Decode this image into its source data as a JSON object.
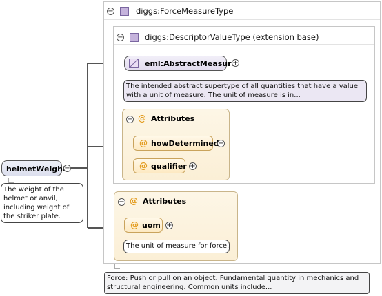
{
  "root_element": {
    "name": "helmetWeight",
    "doc": "The weight of the helmet or anvil, including weight of the striker plate."
  },
  "type": {
    "name": "diggs:ForceMeasureType",
    "doc": "Force: Push or pull on an object. Fundamental quantity in mechanics and structural engineering. Common units include..."
  },
  "base_type": {
    "name": "diggs:DescriptorValueType (extension base)"
  },
  "abstract_element": {
    "name": "eml:AbstractMeasure",
    "doc": "The intended abstract supertype of all quantities that have a value with a unit of measure. The unit of measure is in..."
  },
  "base_attributes": {
    "title": "Attributes",
    "items": [
      {
        "name": "howDetermined"
      },
      {
        "name": "qualifier"
      }
    ]
  },
  "type_attributes": {
    "title": "Attributes",
    "items": [
      {
        "name": "uom",
        "doc": "The unit of measure for force."
      }
    ]
  },
  "symbols": {
    "collapse": "−",
    "expand": "+",
    "attribute": "@"
  },
  "colors": {
    "attribute_accent": "#e39b1d",
    "type_icon": "#c5b3dc",
    "element_fill": "#dcdfee"
  }
}
